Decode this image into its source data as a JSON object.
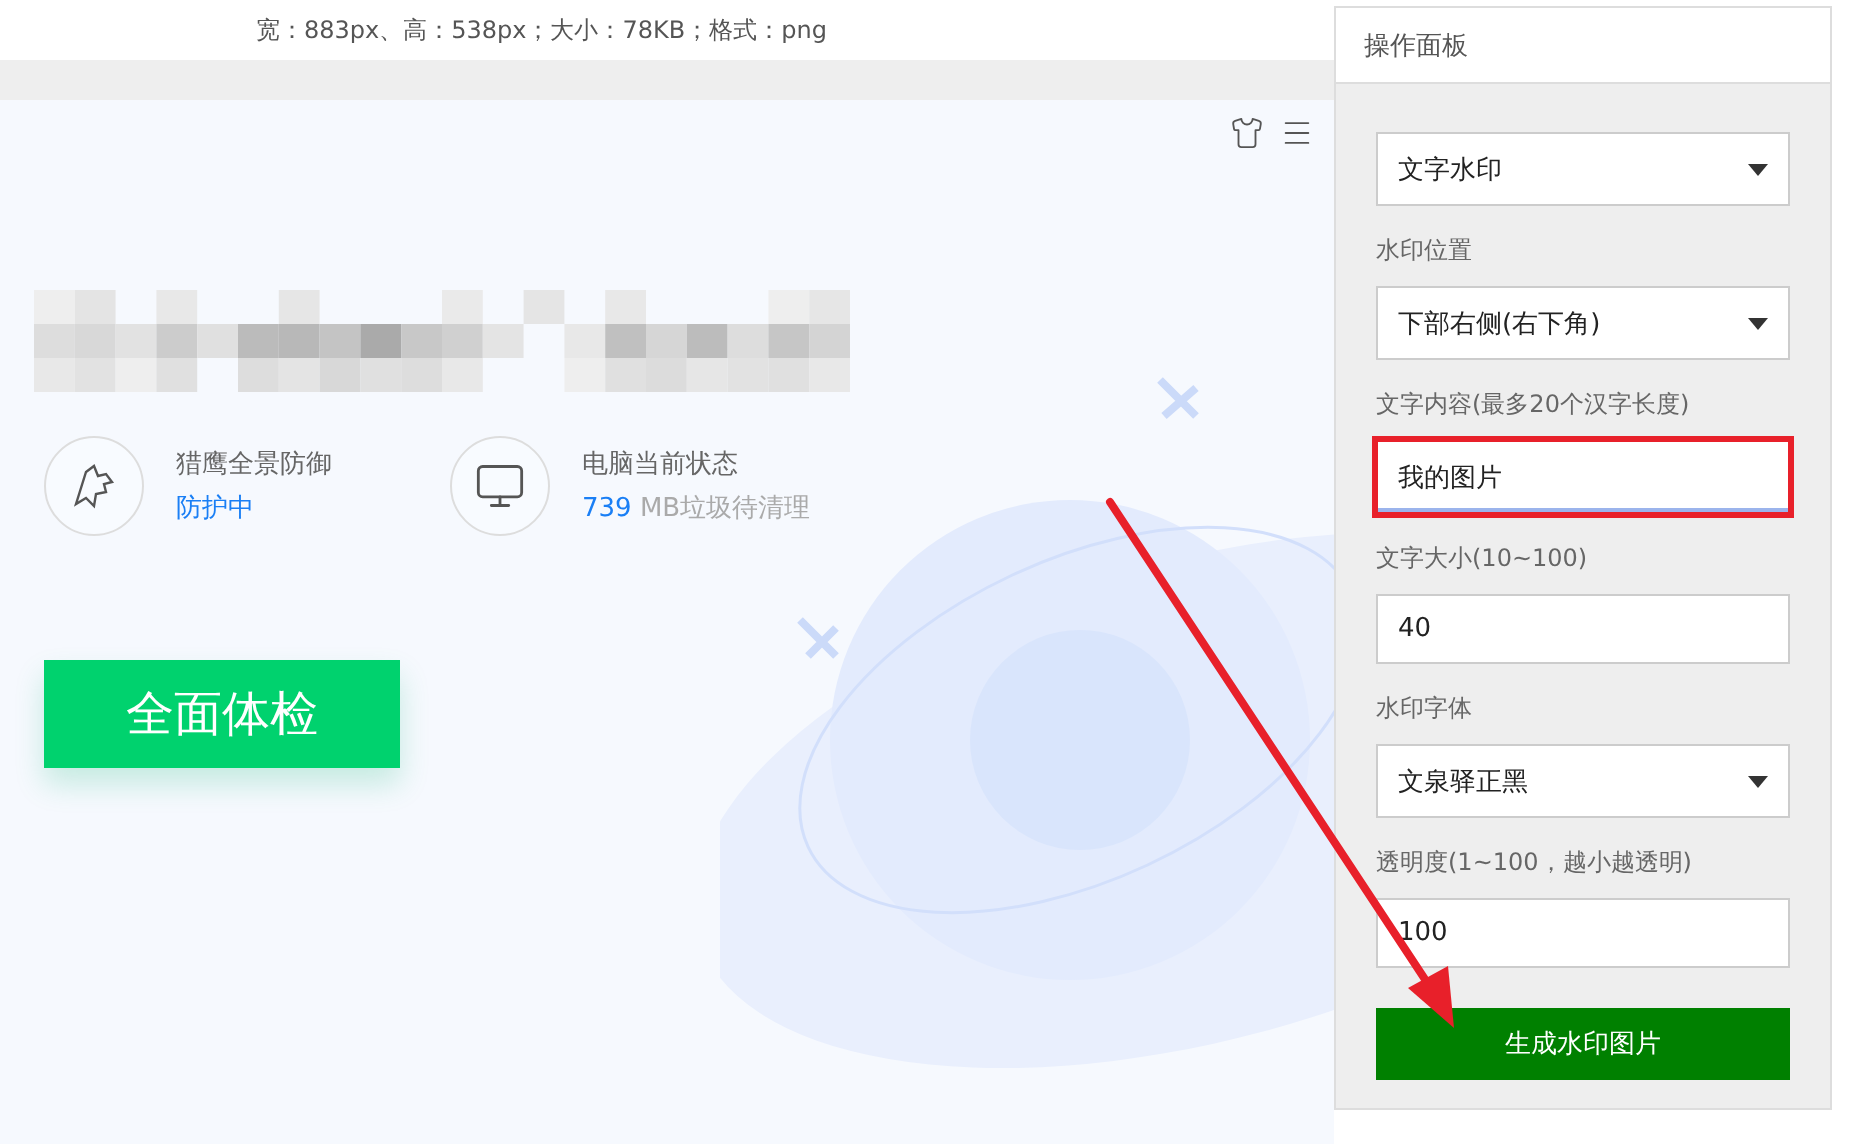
{
  "info_bar": "宽：883px、高：538px；大小：78KB；格式：png",
  "preview": {
    "status_items": [
      {
        "kind": "protection",
        "title": "猎鹰全景防御",
        "status": "防护中"
      },
      {
        "kind": "computer",
        "title": "电脑当前状态",
        "count": "739",
        "detail": "MB垃圾待清理"
      }
    ],
    "scan_button": "全面体检"
  },
  "panel": {
    "title": "操作面板",
    "fields": [
      {
        "kind": "select",
        "value": "文字水印"
      },
      {
        "kind": "select",
        "label": "水印位置",
        "value": "下部右侧(右下角)"
      },
      {
        "kind": "input",
        "label": "文字内容(最多20个汉字长度)",
        "value": "我的图片",
        "highlighted": true
      },
      {
        "kind": "input",
        "label": "文字大小(10~100)",
        "value": "40",
        "highlighted": false
      },
      {
        "kind": "select",
        "label": "水印字体",
        "value": "文泉驿正黑"
      },
      {
        "kind": "input",
        "label": "透明度(1~100，越小越透明)",
        "value": "100",
        "highlighted": false
      }
    ],
    "submit": "生成水印图片"
  }
}
